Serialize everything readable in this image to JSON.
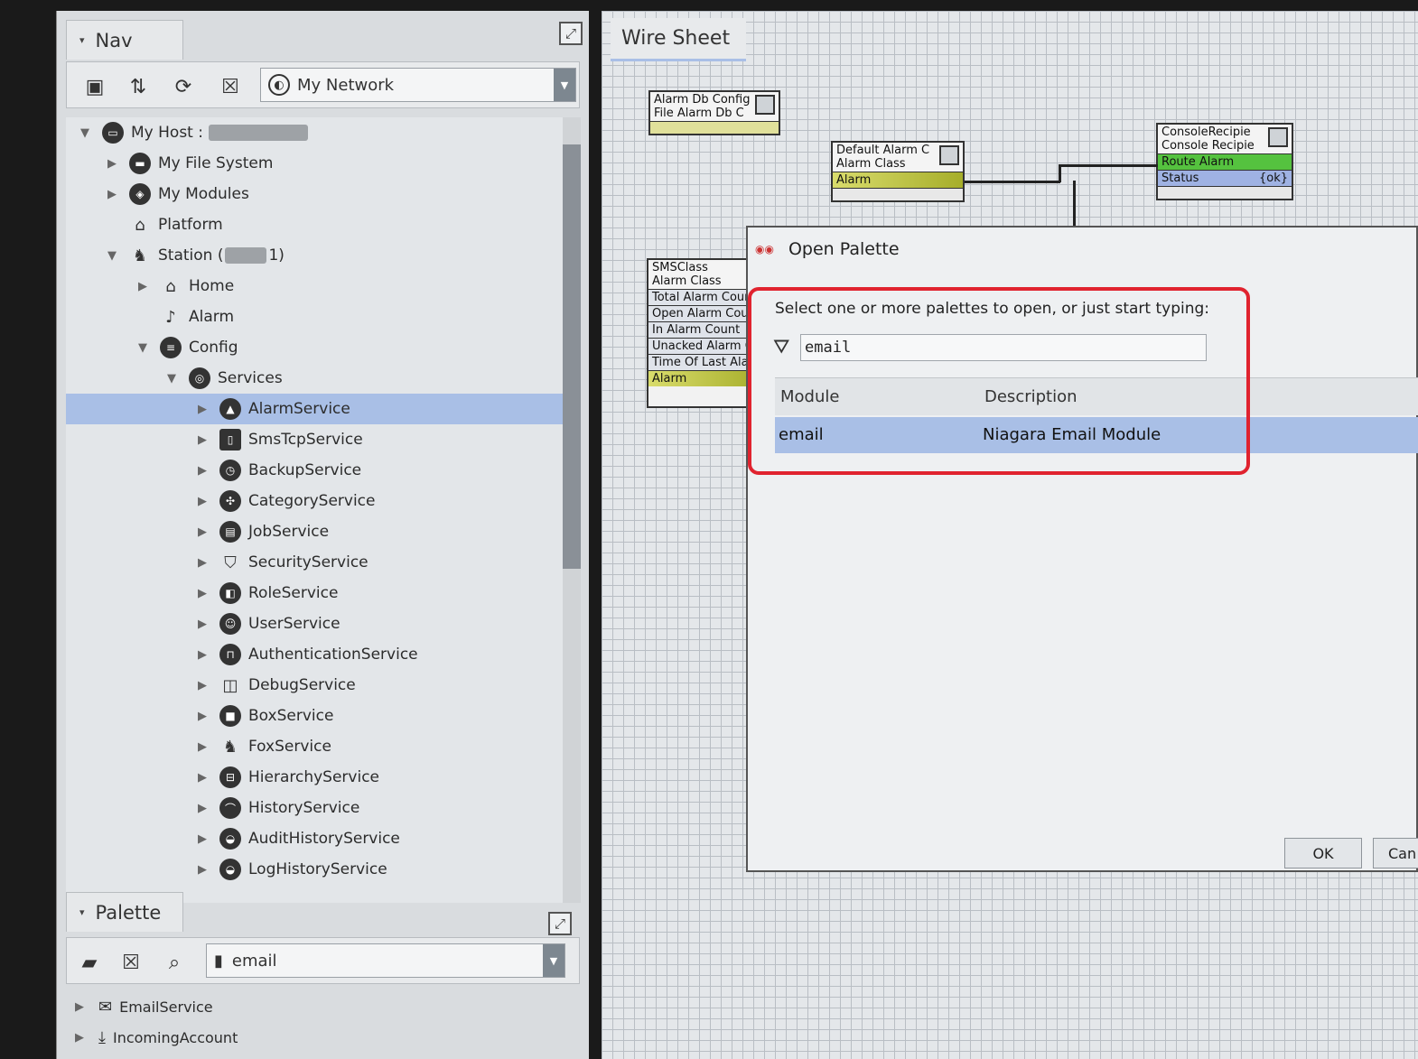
{
  "nav": {
    "title": "Nav",
    "network_combo": "My Network",
    "tree": [
      {
        "label": "My Host :",
        "icon": "host-icon",
        "arrow": "down",
        "redacted": true
      },
      {
        "label": "My File System",
        "icon": "file-system-icon",
        "arrow": "right"
      },
      {
        "label": "My Modules",
        "icon": "modules-icon",
        "arrow": "right"
      },
      {
        "label": "Platform",
        "icon": "platform-icon",
        "arrow": ""
      },
      {
        "label_prefix": "Station (",
        "label_suffix": "1)",
        "icon": "station-icon",
        "arrow": "down"
      },
      {
        "label": "Home",
        "icon": "home-icon",
        "arrow": "right"
      },
      {
        "label": "Alarm",
        "icon": "bell-icon",
        "arrow": ""
      },
      {
        "label": "Config",
        "icon": "config-icon",
        "arrow": "down"
      },
      {
        "label": "Services",
        "icon": "services-icon",
        "arrow": "down"
      },
      {
        "label": "AlarmService",
        "icon": "alarm-service-icon",
        "arrow": "right",
        "selected": true
      },
      {
        "label": "SmsTcpService",
        "icon": "phone-icon",
        "arrow": "right"
      },
      {
        "label": "BackupService",
        "icon": "backup-icon",
        "arrow": "right"
      },
      {
        "label": "CategoryService",
        "icon": "category-icon",
        "arrow": "right"
      },
      {
        "label": "JobService",
        "icon": "job-icon",
        "arrow": "right"
      },
      {
        "label": "SecurityService",
        "icon": "shield-icon",
        "arrow": "right"
      },
      {
        "label": "RoleService",
        "icon": "role-icon",
        "arrow": "right"
      },
      {
        "label": "UserService",
        "icon": "user-icon",
        "arrow": "right"
      },
      {
        "label": "AuthenticationService",
        "icon": "lock-icon",
        "arrow": "right"
      },
      {
        "label": "DebugService",
        "icon": "debug-icon",
        "arrow": "right"
      },
      {
        "label": "BoxService",
        "icon": "box-icon",
        "arrow": "right"
      },
      {
        "label": "FoxService",
        "icon": "fox-icon",
        "arrow": "right"
      },
      {
        "label": "HierarchyService",
        "icon": "hierarchy-icon",
        "arrow": "right"
      },
      {
        "label": "HistoryService",
        "icon": "history-icon",
        "arrow": "right"
      },
      {
        "label": "AuditHistoryService",
        "icon": "audit-history-icon",
        "arrow": "right"
      },
      {
        "label": "LogHistoryService",
        "icon": "log-history-icon",
        "arrow": "right"
      }
    ]
  },
  "palette": {
    "title": "Palette",
    "combo": "email",
    "items": [
      {
        "label": "EmailService",
        "icon": "envelope-icon"
      },
      {
        "label": "IncomingAccount",
        "icon": "download-icon"
      }
    ]
  },
  "wiresheet": {
    "tab": "Wire Sheet",
    "nodes": {
      "alarm_db": {
        "line1": "Alarm Db Config",
        "line2": "File Alarm Db C"
      },
      "default_alarm": {
        "line1": "Default Alarm C",
        "line2": "Alarm Class",
        "slot": "Alarm"
      },
      "console": {
        "line1": "ConsoleRecipie",
        "line2": "Console Recipie",
        "slot1": "Route Alarm",
        "slot2": "Status",
        "slot2_value": "{ok}"
      },
      "sms": {
        "line1": "SMSClass",
        "line2": "Alarm Class",
        "slots": [
          "Total Alarm Count",
          "Open Alarm Count",
          "In Alarm Count",
          "Unacked Alarm Count",
          "Time Of Last Alarm",
          "Alarm"
        ]
      }
    }
  },
  "dialog": {
    "title": "Open Palette",
    "prompt": "Select one or more palettes to open, or just start typing:",
    "filter_value": "email",
    "columns": [
      "Module",
      "Description"
    ],
    "rows": [
      {
        "module": "email",
        "description": "Niagara Email Module"
      }
    ],
    "ok_label": "OK",
    "cancel_label": "Can"
  },
  "colors": {
    "selection": "#a9bfe6",
    "highlight_box": "#e0232f",
    "slot_green": "#55c23f"
  }
}
